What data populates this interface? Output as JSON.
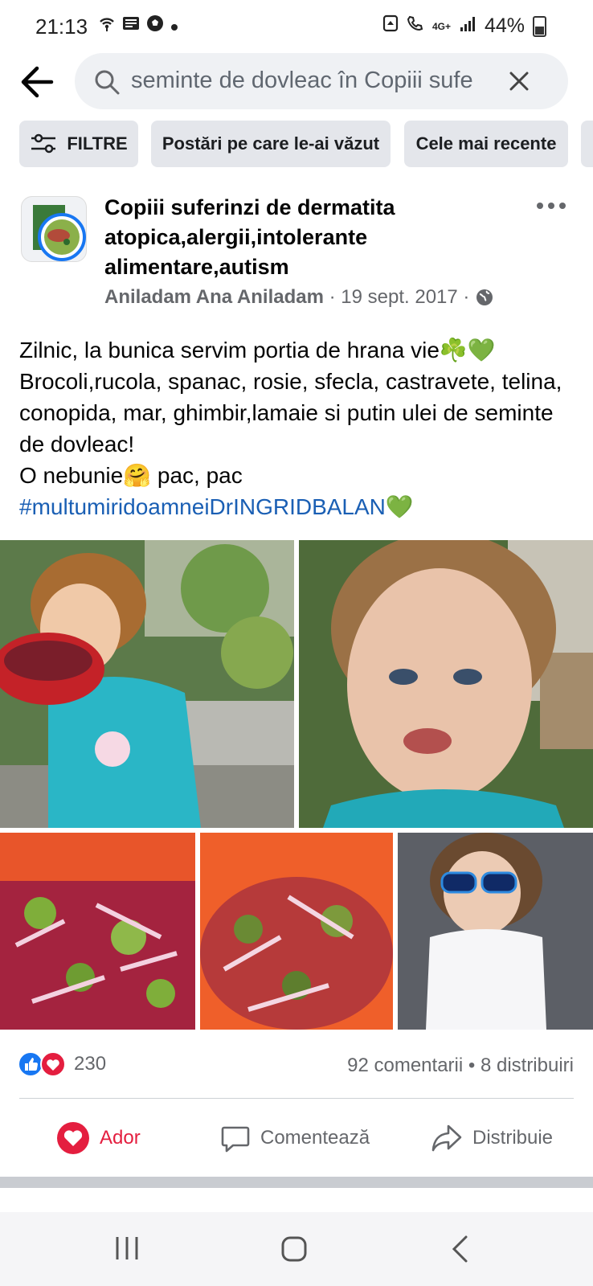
{
  "status_bar": {
    "time": "21:13",
    "network": "4G+",
    "battery": "44%"
  },
  "search": {
    "query": "seminte de dovleac în Copiii suf⁠e"
  },
  "filters": {
    "filter_label": "FILTRE",
    "seen_posts": "Postări pe care le-ai văzut",
    "most_recent": "Cele mai recente"
  },
  "post": {
    "group_name": "Copiii suferinzi de dermatita atopica,alergii,intolerante alimentare,autism",
    "author": "Aniladam Ana Aniladam",
    "date": "19 sept. 2017",
    "text_line1": "Zilnic, la bunica servim portia de hrana vie",
    "text_line2": "Brocoli,rucola, spanac, rosie, sfecla, castravete, telina, conopida, mar, ghimbir,lamaie si putin ulei de seminte de dovleac!",
    "text_line3": "O nebunie",
    "text_line3_tail": " pac, pac",
    "hashtag": "#multumiridoamneiDrINGRIDBALAN",
    "reactions_count": "230",
    "comments": "92 comentarii",
    "shares": "8 distribuiri"
  },
  "actions": {
    "love": "Ador",
    "comment": "Comentează",
    "share": "Distribuie"
  },
  "colors": {
    "love": "#e41e3f",
    "link": "#1a5fb4",
    "like": "#1877f2"
  }
}
